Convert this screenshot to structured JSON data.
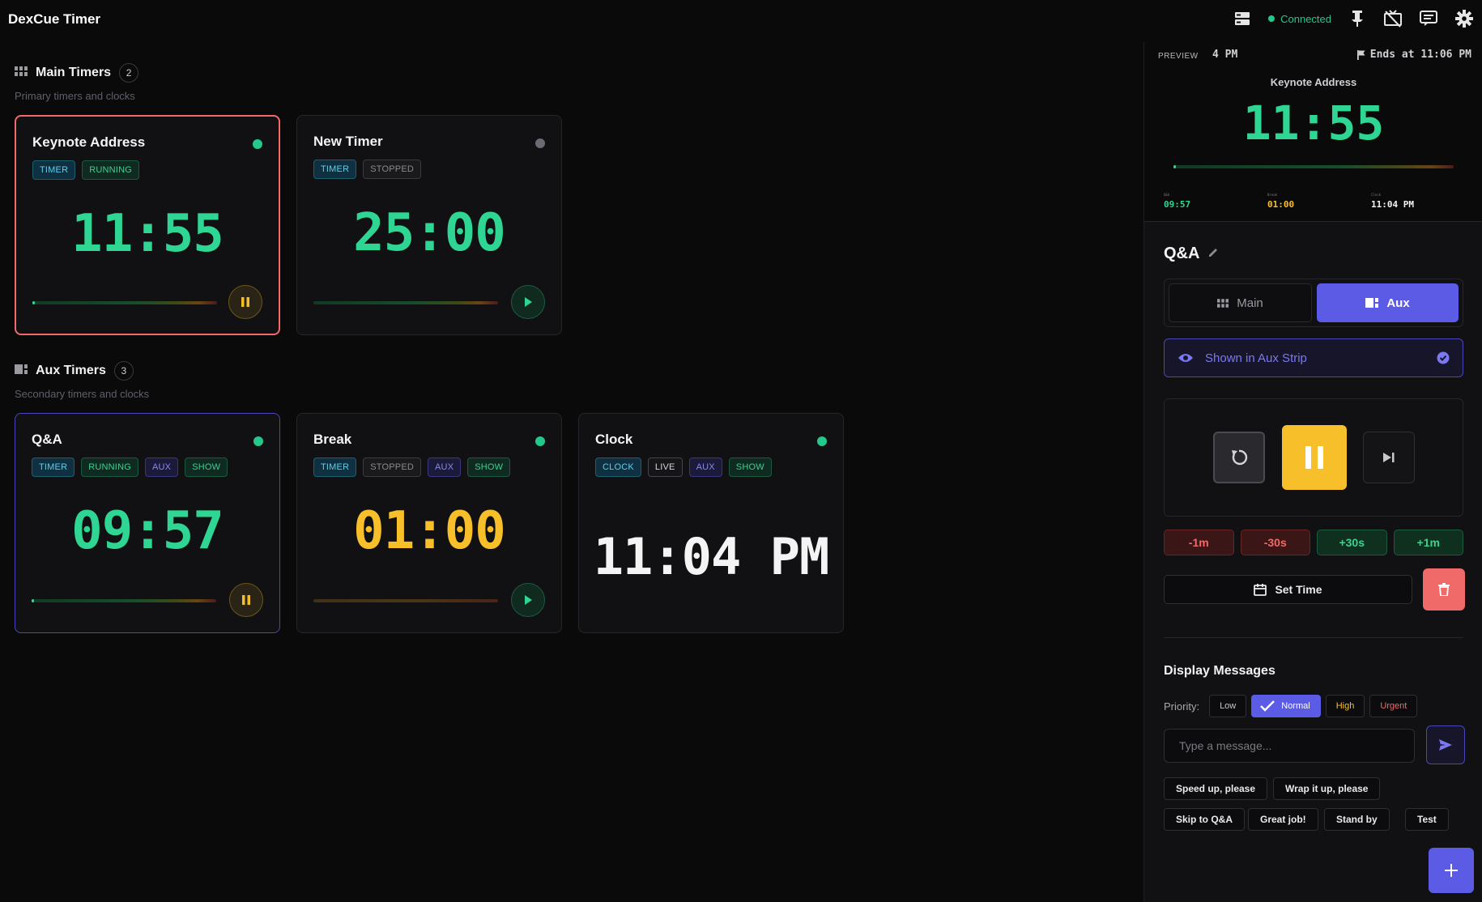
{
  "app": {
    "title": "DexCue Timer"
  },
  "topbar": {
    "status": "Connected"
  },
  "main_section": {
    "title": "Main Timers",
    "count": "2",
    "subtitle": "Primary timers and clocks"
  },
  "aux_section": {
    "title": "Aux Timers",
    "count": "3",
    "subtitle": "Secondary timers and clocks"
  },
  "main_timers": [
    {
      "name": "Keynote Address",
      "tags": [
        "TIMER",
        "RUNNING"
      ],
      "time": "11:55",
      "status_color": "#23c88a",
      "state": "running"
    },
    {
      "name": "New Timer",
      "tags": [
        "TIMER",
        "STOPPED"
      ],
      "time": "25:00",
      "status_color": "#6a6a72",
      "state": "stopped"
    }
  ],
  "aux_timers": [
    {
      "name": "Q&A",
      "tags": [
        "TIMER",
        "RUNNING",
        "AUX",
        "SHOW"
      ],
      "time": "09:57",
      "state": "running"
    },
    {
      "name": "Break",
      "tags": [
        "TIMER",
        "STOPPED",
        "AUX",
        "SHOW"
      ],
      "time": "01:00",
      "state": "stopped"
    },
    {
      "name": "Clock",
      "tags": [
        "CLOCK",
        "LIVE",
        "AUX",
        "SHOW"
      ],
      "time": "11:04 PM",
      "state": "live"
    }
  ],
  "preview": {
    "label": "PREVIEW",
    "now_fragment": "4 PM",
    "ends": "Ends at 11:06 PM",
    "title": "Keynote Address",
    "time": "11:55",
    "strip": [
      {
        "caption": "Q&A",
        "value": "09:57",
        "color": "#2fd693"
      },
      {
        "caption": "Break",
        "value": "01:00",
        "color": "#f7c02a"
      },
      {
        "caption": "Clock",
        "value": "11:04 PM",
        "color": "#f4f4f4"
      }
    ]
  },
  "selected": {
    "title": "Q&A",
    "mode_main": "Main",
    "mode_aux": "Aux",
    "shown_label": "Shown in Aux Strip",
    "adjust": [
      "-1m",
      "-30s",
      "+30s",
      "+1m"
    ],
    "set_time": "Set Time"
  },
  "messages": {
    "title": "Display Messages",
    "priority_label": "Priority:",
    "priorities": [
      "Low",
      "Normal",
      "High",
      "Urgent"
    ],
    "selected_priority": "Normal",
    "placeholder": "Type a message...",
    "quick": [
      "Speed up, please",
      "Wrap it up, please",
      "Skip to Q&A",
      "Great job!",
      "Stand by",
      "Test"
    ]
  },
  "colors": {
    "accent": "#5b5be6",
    "green": "#2fd693",
    "yellow": "#f7c02a",
    "red": "#f06a6a"
  }
}
